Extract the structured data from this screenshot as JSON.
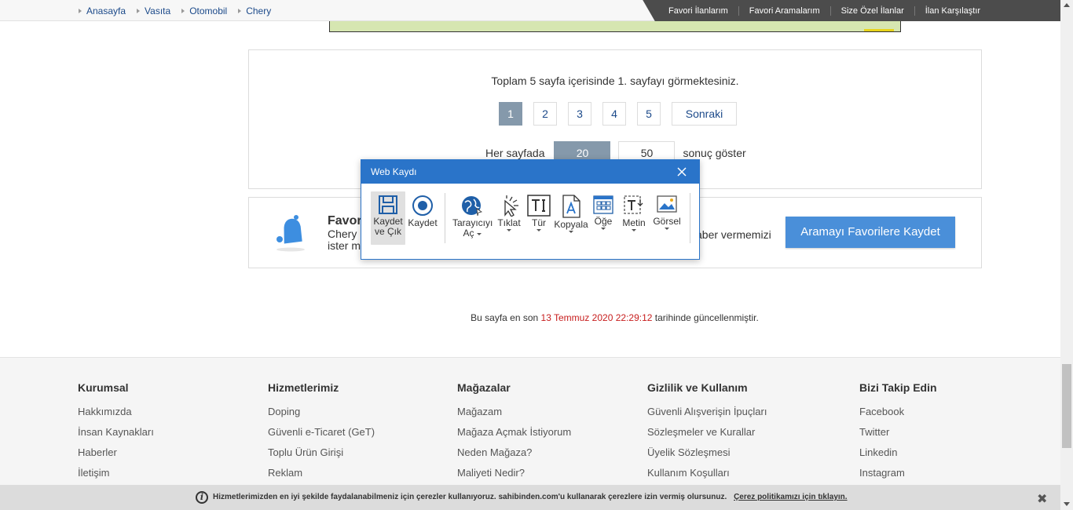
{
  "breadcrumbs": [
    "Anasayfa",
    "Vasıta",
    "Otomobil",
    "Chery"
  ],
  "top_links": [
    "Favori İlanlarım",
    "Favori Aramalarım",
    "Size Özel İlanlar",
    "İlan Karşılaştır"
  ],
  "pagination": {
    "info": "Toplam 5 sayfa içerisinde 1. sayfayı görmektesiniz.",
    "pages": [
      "1",
      "2",
      "3",
      "4",
      "5"
    ],
    "next_label": "Sonraki",
    "per_page_label": "Her sayfada",
    "per_page_options": [
      "20",
      "50"
    ],
    "per_page_suffix": "sonuç göster"
  },
  "favorites": {
    "title": "Favor",
    "desc_line1": "Chery l",
    "desc_line2": "ister m",
    "desc_tail": "aber vermemizi",
    "button_label": "Aramayı Favorilere Kaydet"
  },
  "updated": {
    "prefix": "Bu sayfa en son",
    "date": "13 Temmuz 2020 22:29:12",
    "suffix": "tarihinde güncellenmiştir."
  },
  "footer": {
    "columns": [
      {
        "title": "Kurumsal",
        "links": [
          "Hakkımızda",
          "İnsan Kaynakları",
          "Haberler",
          "İletişim"
        ]
      },
      {
        "title": "Hizmetlerimiz",
        "links": [
          "Doping",
          "Güvenli e-Ticaret (GeT)",
          "Toplu Ürün Girişi",
          "Reklam"
        ]
      },
      {
        "title": "Mağazalar",
        "links": [
          "Mağazam",
          "Mağaza Açmak İstiyorum",
          "Neden Mağaza?",
          "Maliyeti Nedir?"
        ]
      },
      {
        "title": "Gizlilik ve Kullanım",
        "links": [
          "Güvenli Alışverişin İpuçları",
          "Sözleşmeler ve Kurallar",
          "Üyelik Sözleşmesi",
          "Kullanım Koşulları"
        ]
      },
      {
        "title": "Bizi Takip Edin",
        "links": [
          "Facebook",
          "Twitter",
          "Linkedin",
          "Instagram"
        ]
      }
    ]
  },
  "cookie": {
    "text": "Hizmetlerimizden en iyi şekilde faydalanabilmeniz için çerezler kullanıyoruz. sahibinden.com'u kullanarak çerezlere izin vermiş olursunuz.",
    "link": "Çerez politikamızı için tıklayın."
  },
  "dialog": {
    "title": "Web Kaydı",
    "tools": {
      "save_exit_1": "Kaydet",
      "save_exit_2": "ve Çık",
      "record": "Kaydet",
      "browser_1": "Tarayıcıyı",
      "browser_2": "Aç",
      "click": "Tıklat",
      "type": "Tür",
      "copy": "Kopyala",
      "element": "Öğe",
      "text": "Metin",
      "image": "Görsel"
    }
  },
  "colors": {
    "accent": "#2a74c9",
    "button": "#4a8fd9",
    "active_page": "#8599ab",
    "date_red": "#c71d1d"
  }
}
